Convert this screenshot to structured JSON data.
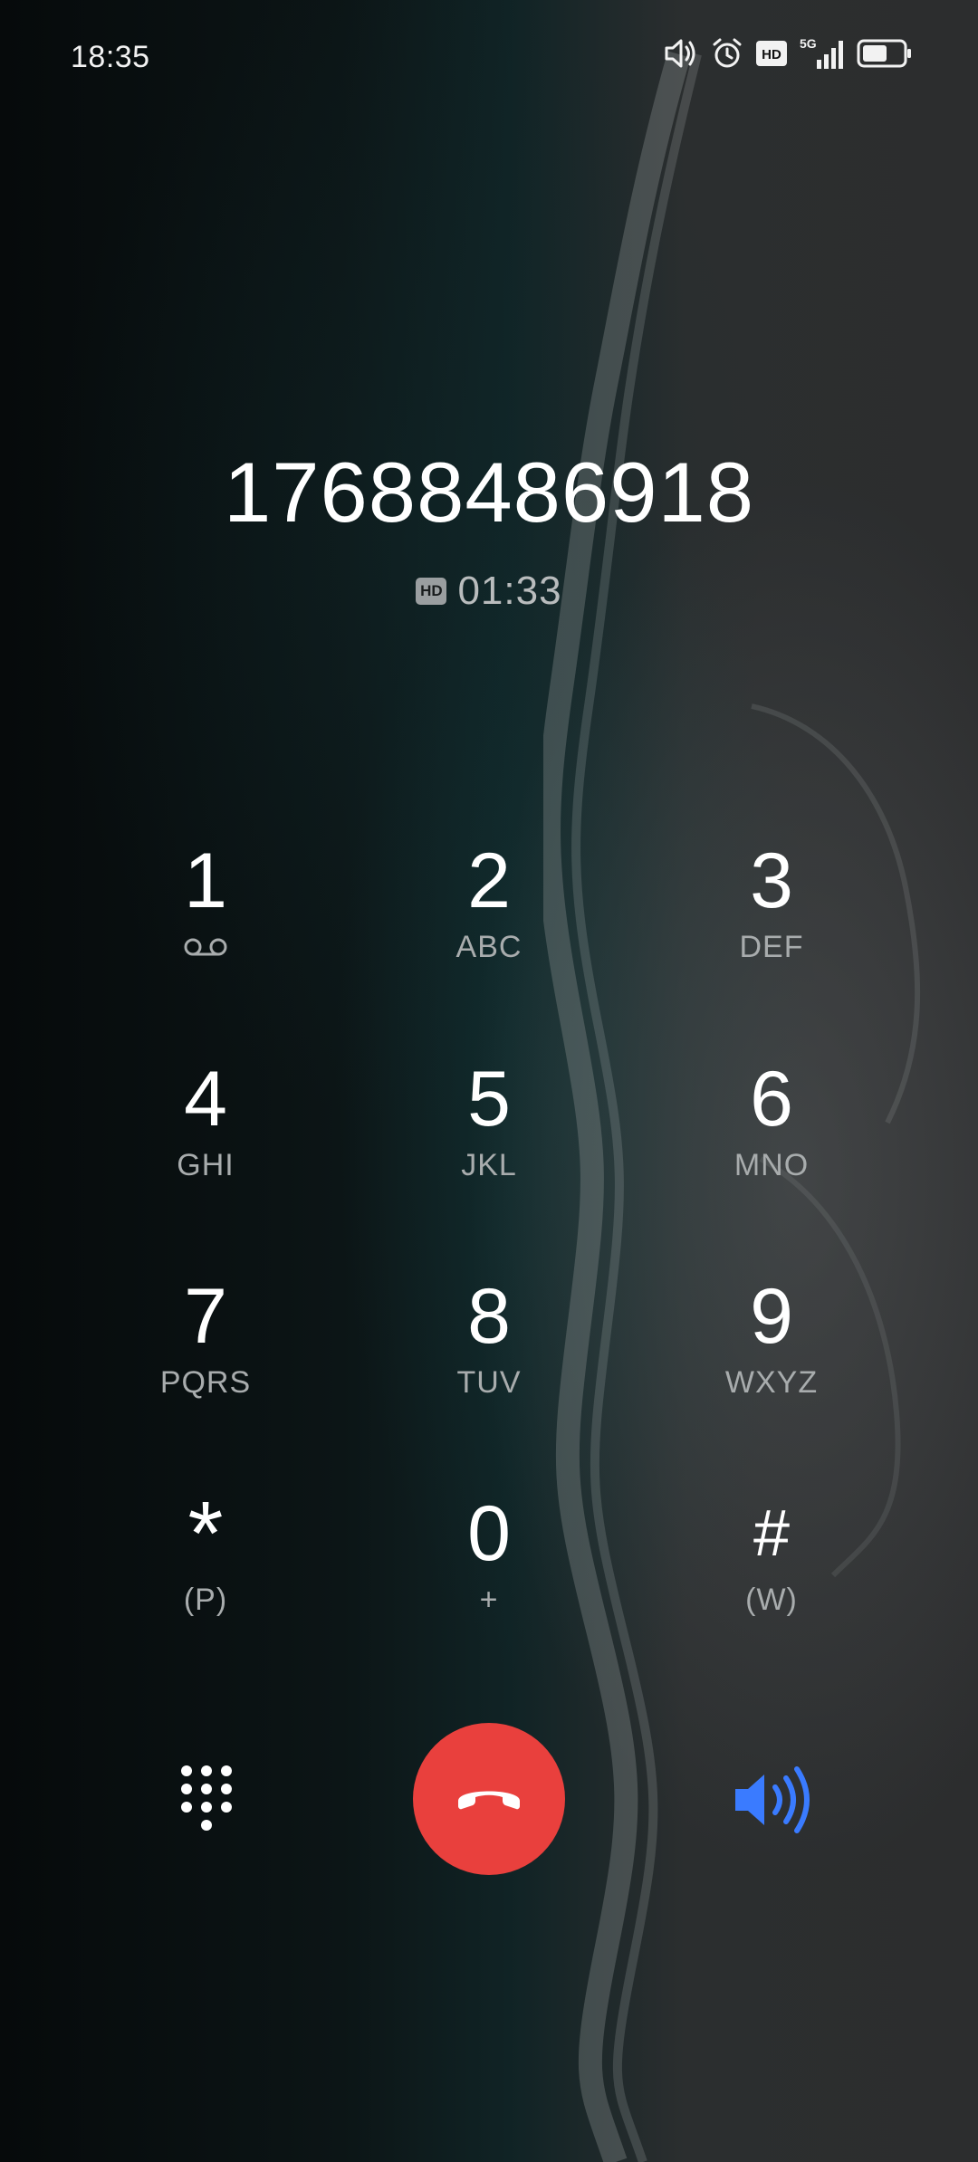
{
  "status_bar": {
    "time": "18:35",
    "icons": [
      "volume-icon",
      "alarm-icon",
      "hd-voice-icon",
      "5g-signal-icon",
      "battery-icon"
    ],
    "hd_label": "HD",
    "network_label": "5G"
  },
  "call": {
    "number": "17688486918",
    "hd_badge": "HD",
    "duration": "01:33"
  },
  "keypad": {
    "keys": [
      {
        "digit": "1",
        "letters": "",
        "icon": "voicemail-icon"
      },
      {
        "digit": "2",
        "letters": "ABC"
      },
      {
        "digit": "3",
        "letters": "DEF"
      },
      {
        "digit": "4",
        "letters": "GHI"
      },
      {
        "digit": "5",
        "letters": "JKL"
      },
      {
        "digit": "6",
        "letters": "MNO"
      },
      {
        "digit": "7",
        "letters": "PQRS"
      },
      {
        "digit": "8",
        "letters": "TUV"
      },
      {
        "digit": "9",
        "letters": "WXYZ"
      },
      {
        "digit": "*",
        "letters": "(P)"
      },
      {
        "digit": "0",
        "letters": "+"
      },
      {
        "digit": "#",
        "letters": "(W)"
      }
    ]
  },
  "actions": {
    "dialpad_icon": "dialpad-icon",
    "end_call_icon": "end-call-icon",
    "speaker_icon": "speaker-icon"
  },
  "colors": {
    "end_call": "#e9403d",
    "speaker_active": "#3a7bff",
    "text_primary": "#ffffff",
    "text_secondary": "#a8acad"
  }
}
